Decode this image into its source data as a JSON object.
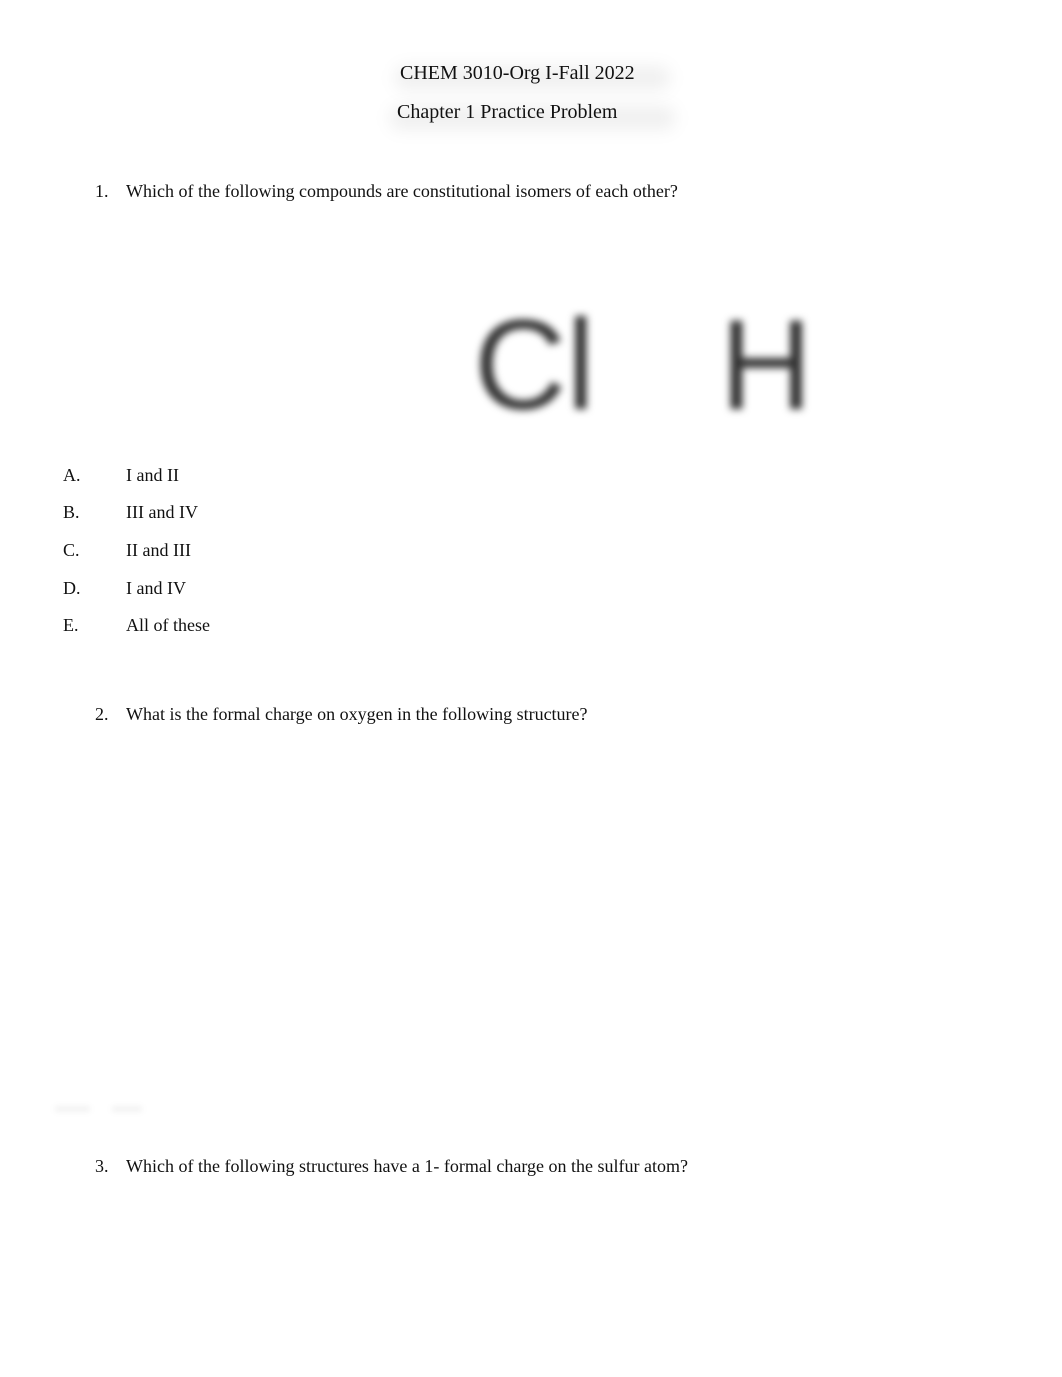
{
  "header": {
    "course": "CHEM 3010-Org I-Fall 2022",
    "subtitle": "Chapter 1 Practice Problem"
  },
  "questions": [
    {
      "number": "1.",
      "text": "Which of the following compounds are constitutional isomers of each other?",
      "figure_labels": [
        "Cl",
        "H"
      ],
      "options": [
        {
          "letter": "A.",
          "text": "I and II"
        },
        {
          "letter": "B.",
          "text": "III and IV"
        },
        {
          "letter": "C.",
          "text": "II and III"
        },
        {
          "letter": "D.",
          "text": "I and IV"
        },
        {
          "letter": "E.",
          "text": "All of these"
        }
      ]
    },
    {
      "number": "2.",
      "text": "What is the formal charge on oxygen in the following structure?"
    },
    {
      "number": "3.",
      "text": "Which of the following structures have a 1- formal charge on the sulfur atom?"
    }
  ]
}
